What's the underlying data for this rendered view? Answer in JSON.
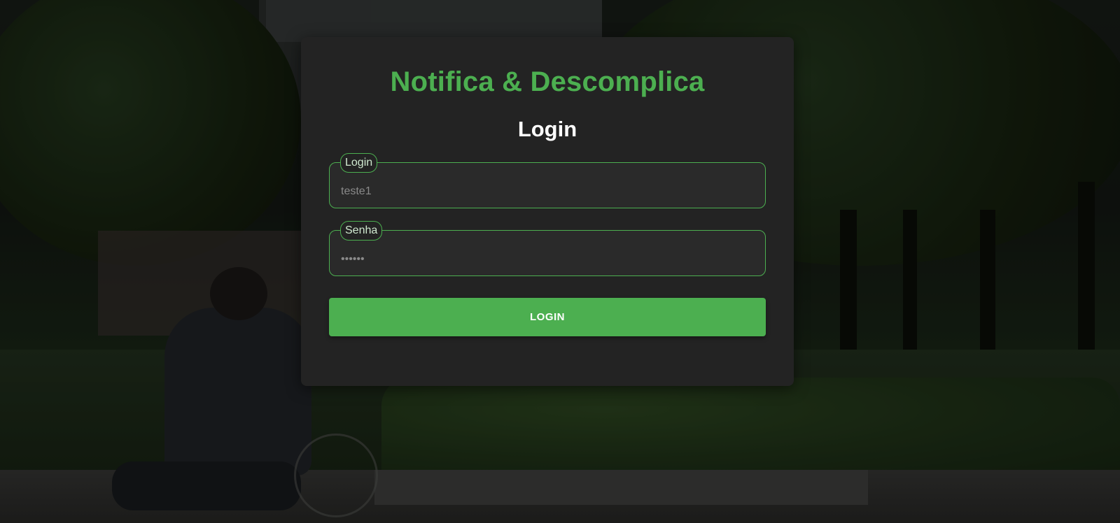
{
  "app": {
    "brand": "Notifica & Descomplica",
    "heading": "Login"
  },
  "form": {
    "login_field": {
      "legend": "Login",
      "value": "teste1"
    },
    "password_field": {
      "legend": "Senha",
      "value": "••••••"
    },
    "submit_label": "LOGIN"
  },
  "colors": {
    "accent": "#4caf50",
    "card": "#232323",
    "heading": "#ffffff"
  }
}
